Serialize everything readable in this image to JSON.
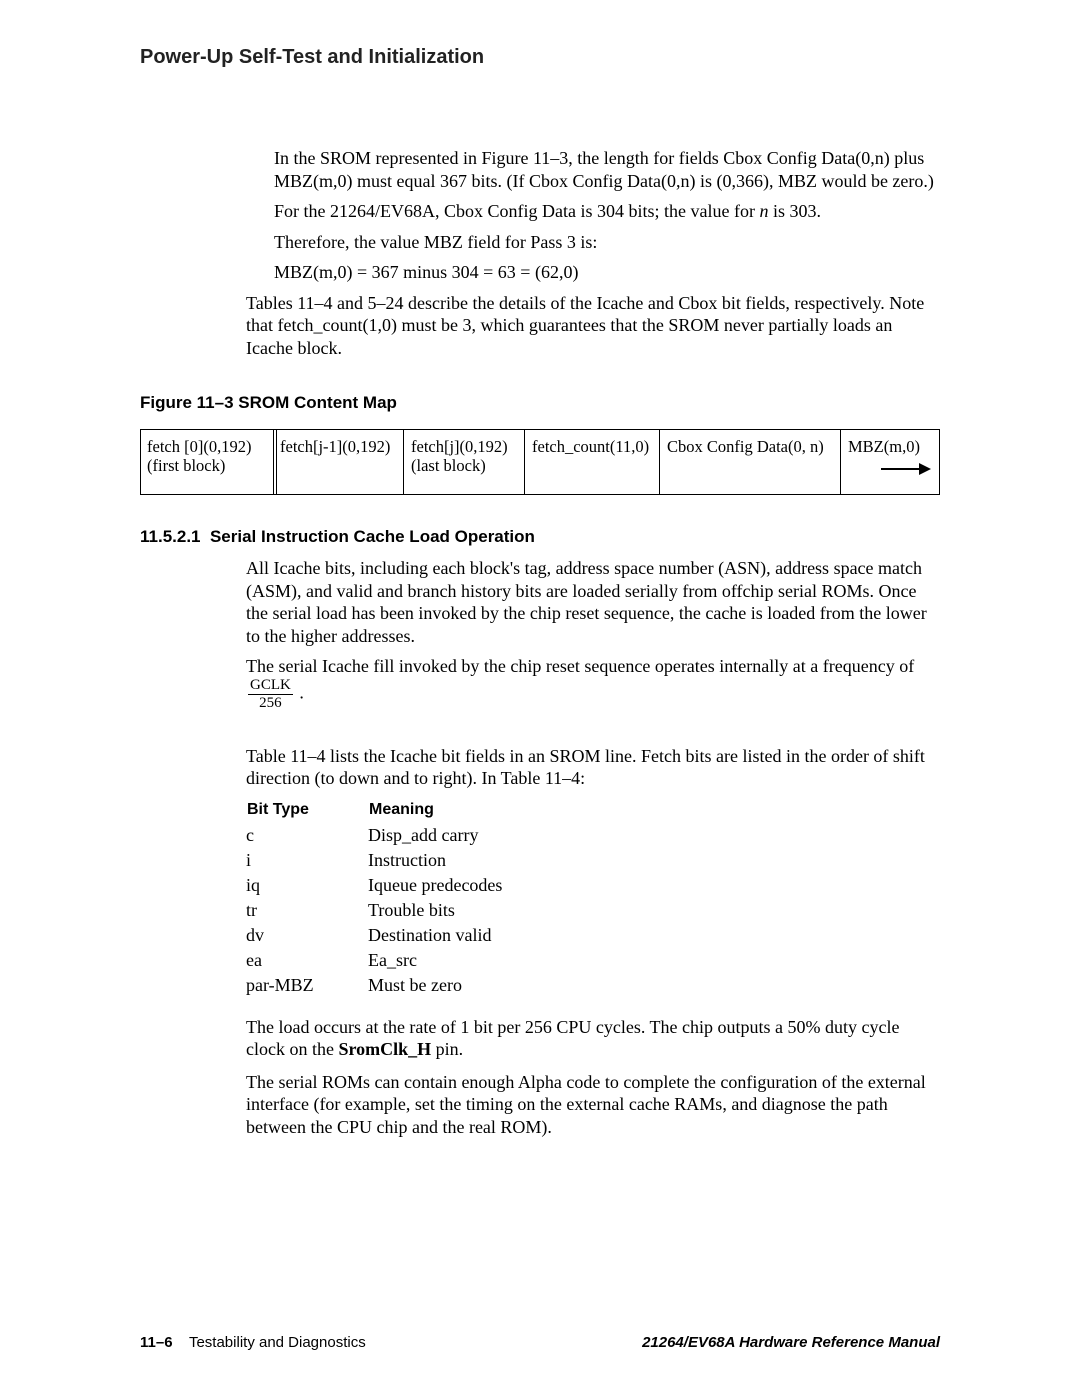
{
  "running_head": "Power-Up Self-Test and Initialization",
  "intro": {
    "p1": "In the SROM represented in Figure 11–3, the length for fields Cbox Config Data(0,n) plus MBZ(m,0) must equal 367 bits. (If Cbox Config Data(0,n) is (0,366), MBZ would be zero.)",
    "p2_a": "For the 21264/EV68A, Cbox Config Data is 304 bits; the value for ",
    "p2_n": "n",
    "p2_b": " is 303.",
    "p3": "Therefore, the value MBZ field for Pass 3 is:",
    "p4": "MBZ(m,0) =  367 minus 304 = 63 = (62,0)"
  },
  "tables_note": "Tables 11–4 and 5–24 describe the details of the Icache and Cbox bit fields, respectively.  Note that fetch_count(1,0) must be 3, which guarantees that the SROM never partially loads an Icache block.",
  "figure": {
    "title": "Figure 11–3  SROM Content Map",
    "cells": [
      {
        "top": "fetch [0](0,192)",
        "bottom": "(first block)"
      },
      {
        "top": "fetch[j-1](0,192)",
        "bottom": ""
      },
      {
        "top": "fetch[j](0,192)",
        "bottom": "(last block)"
      },
      {
        "top": "fetch_count(11,0)",
        "bottom": ""
      },
      {
        "top": "Cbox Config Data(0, n)",
        "bottom": ""
      },
      {
        "top": "MBZ(m,0)",
        "bottom": ""
      }
    ]
  },
  "subsection": {
    "number": "11.5.2.1",
    "title": "Serial Instruction Cache Load Operation",
    "p1": "All Icache bits, including each block's tag, address space number (ASN), address space match (ASM), and valid and branch history bits are loaded serially from offchip serial ROMs. Once the serial load has been invoked by the chip reset sequence, the cache is loaded from the lower to the higher addresses.",
    "p2_a": "The serial Icache fill invoked by the chip reset sequence operates internally at a frequency of ",
    "p2_num": "GCLK",
    "p2_den": "256",
    "p2_b": " .",
    "p3": "Table 11–4 lists the Icache bit fields in an SROM line. Fetch bits are listed in the order of shift direction (to down and to right). In Table 11–4:"
  },
  "bit_type_headers": {
    "col1": "Bit Type",
    "col2": "Meaning"
  },
  "bit_types": [
    {
      "t": "c",
      "m": "Disp_add carry"
    },
    {
      "t": "i",
      "m": "Instruction"
    },
    {
      "t": "iq",
      "m": "Iqueue predecodes"
    },
    {
      "t": "tr",
      "m": "Trouble bits"
    },
    {
      "t": "dv",
      "m": "Destination valid"
    },
    {
      "t": "ea",
      "m": "Ea_src"
    },
    {
      "t": "par-MBZ",
      "m": "Must be zero"
    }
  ],
  "tail": {
    "p1_a": "The load occurs at the rate of 1 bit per 256 CPU cycles. The chip outputs a 50% duty cycle clock on the ",
    "p1_pin": "SromClk_H",
    "p1_b": " pin.",
    "p2": "The serial ROMs can contain enough Alpha code to complete the configuration of the external interface (for example,  set the timing on the external cache RAMs, and diagnose the path between the CPU chip and the real ROM)."
  },
  "footer": {
    "page": "11–6",
    "section": "Testability and Diagnostics",
    "doc": "21264/EV68A Hardware Reference Manual"
  }
}
